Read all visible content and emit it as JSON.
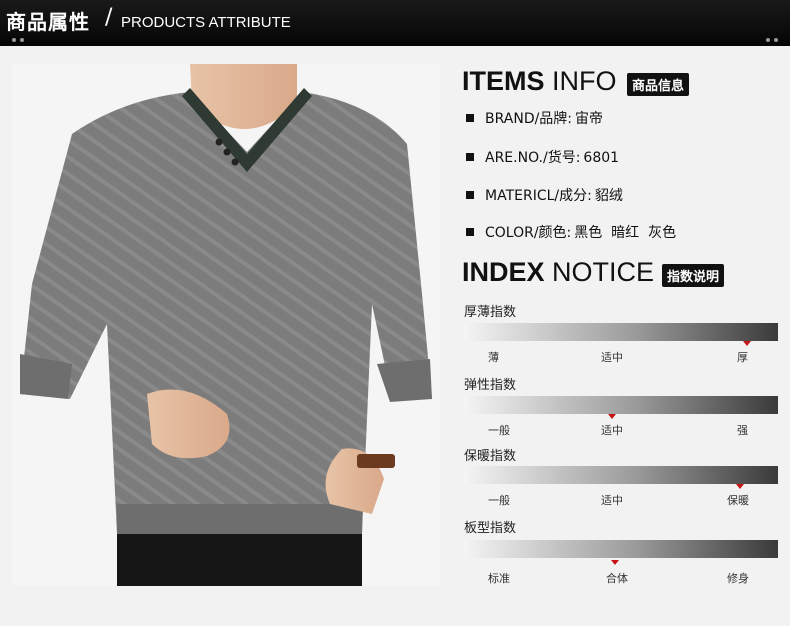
{
  "header": {
    "title_cn": "商品属性",
    "separator": "/",
    "title_en": "PRODUCTS ATTRIBUTE"
  },
  "items_info": {
    "title_bold": "ITEMS",
    "title_light": "INFO",
    "badge": "商品信息",
    "rows": [
      {
        "label": "BRAND/品牌:",
        "value": "宙帝"
      },
      {
        "label": "ARE.NO./货号:",
        "value": "6801"
      },
      {
        "label": "MATERICL/成分:",
        "value": "貂绒"
      },
      {
        "label": "COLOR/颜色:",
        "value": "黑色  暗红  灰色"
      }
    ]
  },
  "index_notice": {
    "title_bold": "INDEX",
    "title_light": "NOTICE",
    "badge": "指数说明",
    "indices": [
      {
        "name": "厚薄指数",
        "ticks": [
          "薄",
          "适中",
          "厚"
        ],
        "level": 0.9
      },
      {
        "name": "弹性指数",
        "ticks": [
          "一般",
          "适中",
          "强"
        ],
        "level": 0.47
      },
      {
        "name": "保暖指数",
        "ticks": [
          "一般",
          "适中",
          "保暖"
        ],
        "level": 0.88
      },
      {
        "name": "板型指数",
        "ticks": [
          "标准",
          "合体",
          "修身"
        ],
        "level": 0.48
      }
    ]
  },
  "colors": {
    "header_bg": "#0f0f0f",
    "marker": "#c81414",
    "sweater": "#7c7c7c"
  }
}
